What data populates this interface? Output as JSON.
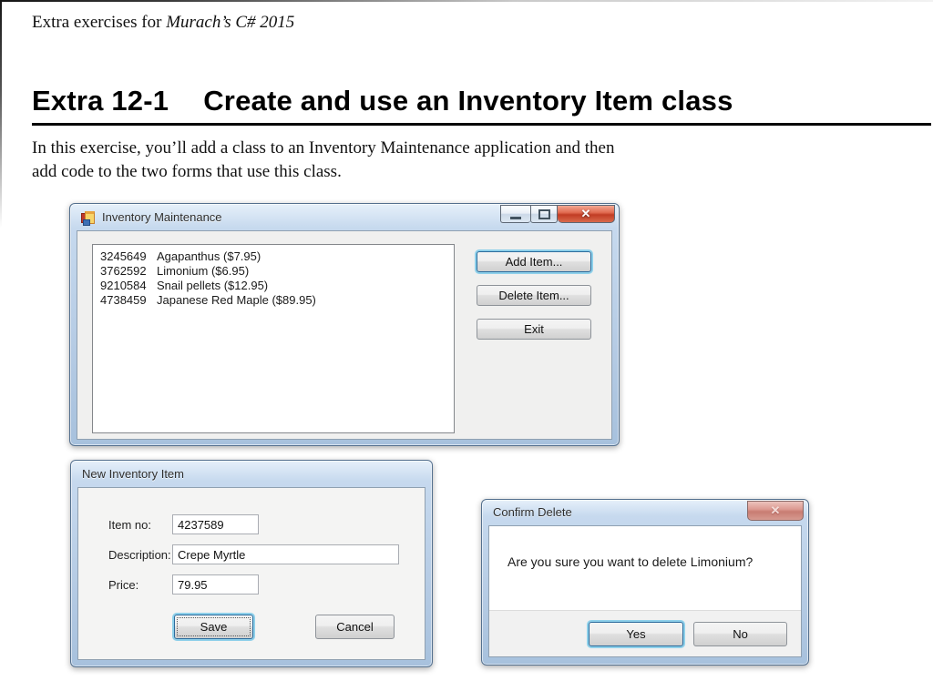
{
  "page": {
    "header": {
      "prefix": "Extra exercises for ",
      "book_title": "Murach’s C# 2015"
    },
    "heading": {
      "number": "Extra 12-1",
      "title": "Create and use an Inventory Item class"
    },
    "intro": {
      "line1": "In this exercise, you’ll add a class to an Inventory Maintenance application and then",
      "line2": "add code to the two forms that use this class."
    }
  },
  "inventory_window": {
    "title": "Inventory Maintenance",
    "list_items": [
      {
        "number": "3245649",
        "description": "Agapanthus ($7.95)"
      },
      {
        "number": "3762592",
        "description": "Limonium ($6.95)"
      },
      {
        "number": "9210584",
        "description": "Snail pellets ($12.95)"
      },
      {
        "number": "4738459",
        "description": "Japanese Red Maple ($89.95)"
      }
    ],
    "buttons": {
      "add": "Add Item...",
      "delete": "Delete Item...",
      "exit": "Exit"
    },
    "window_controls": {
      "close_glyph": "✕"
    }
  },
  "new_item_window": {
    "title": "New Inventory Item",
    "fields": [
      {
        "label": "Item no:",
        "value": "4237589"
      },
      {
        "label": "Description:",
        "value": "Crepe Myrtle"
      },
      {
        "label": "Price:",
        "value": "79.95"
      }
    ],
    "buttons": {
      "save": "Save",
      "cancel": "Cancel"
    }
  },
  "confirm_dialog": {
    "title": "Confirm Delete",
    "message": "Are you sure you want to delete Limonium?",
    "buttons": {
      "yes": "Yes",
      "no": "No"
    },
    "window_controls": {
      "close_glyph": "✕"
    }
  },
  "icons": {
    "app_icon": "winforms-form-icon",
    "minimize": "minimize-icon",
    "maximize": "maximize-icon",
    "close": "close-icon"
  },
  "colors": {
    "focus_border": "#2a6a9b",
    "focus_glow": "#8ed0ea",
    "close_button_red": "#c13c24",
    "title_bar_blue": "#b5cbe4",
    "client_bg": "#f0f0ef",
    "heading_rule": "#000000"
  }
}
